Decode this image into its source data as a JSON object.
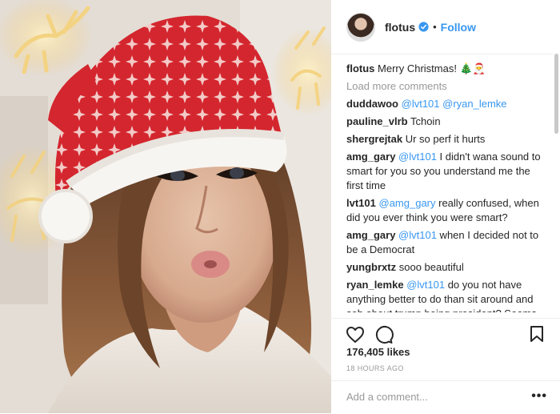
{
  "header": {
    "username": "flotus",
    "separator": "•",
    "follow_label": "Follow",
    "verified_icon": "verified-badge-icon"
  },
  "caption": {
    "username": "flotus",
    "text": "Merry Christmas! 🎄🎅"
  },
  "load_more_label": "Load more comments",
  "comments": [
    {
      "user": "duddawoo",
      "parts": [
        {
          "mention": "@lvt101"
        },
        {
          "text": " "
        },
        {
          "mention": "@ryan_lemke"
        }
      ]
    },
    {
      "user": "pauline_vlrb",
      "parts": [
        {
          "text": "Tchoin"
        }
      ]
    },
    {
      "user": "shergrejtak",
      "parts": [
        {
          "text": "Ur so perf it hurts"
        }
      ]
    },
    {
      "user": "amg_gary",
      "parts": [
        {
          "mention": "@lvt101"
        },
        {
          "text": " I didn't wana sound to smart for you so you understand me the first time"
        }
      ]
    },
    {
      "user": "lvt101",
      "parts": [
        {
          "mention": "@amg_gary"
        },
        {
          "text": " really confused, when did you ever think you were smart?"
        }
      ]
    },
    {
      "user": "amg_gary",
      "parts": [
        {
          "mention": "@lvt101"
        },
        {
          "text": " when I decided not to be a Democrat"
        }
      ]
    },
    {
      "user": "yungbrxtz",
      "parts": [
        {
          "text": "sooo beautiful"
        }
      ]
    },
    {
      "user": "ryan_lemke",
      "parts": [
        {
          "mention": "@lvt101"
        },
        {
          "text": " do you not have anything better to do than sit around and sob about trump being president? Seems like all I've heard since he got elected is"
        }
      ]
    }
  ],
  "likes": "176,405 likes",
  "timestamp": "18 HOURS AGO",
  "add_comment_placeholder": "Add a comment...",
  "more_label": "•••",
  "icons": {
    "like": "heart-icon",
    "comment": "comment-bubble-icon",
    "save": "bookmark-icon"
  },
  "colors": {
    "accent": "#3897f0",
    "text": "#262626",
    "muted": "#999999",
    "hat_red": "#d4262e"
  }
}
